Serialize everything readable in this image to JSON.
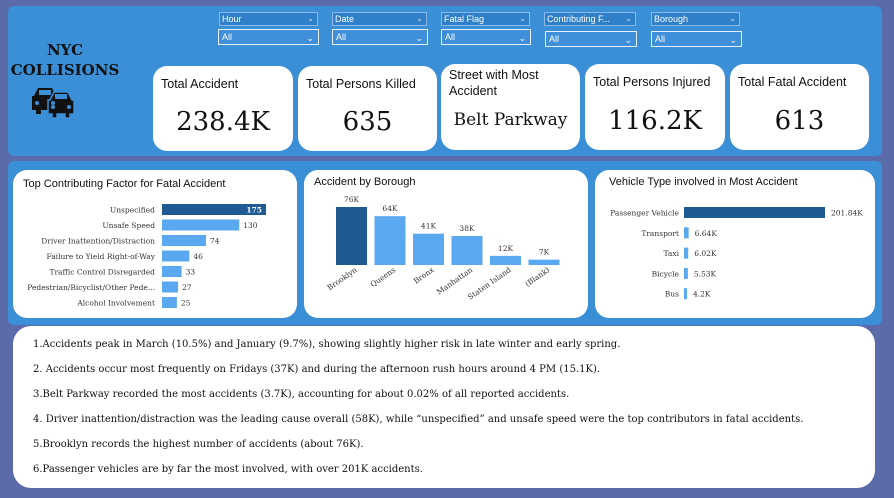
{
  "brand": {
    "line1": "NYC",
    "line2": "COLLISIONS"
  },
  "filters": [
    {
      "label": "Hour",
      "value": "All"
    },
    {
      "label": "Date",
      "value": "All"
    },
    {
      "label": "Fatal Flag",
      "value": "All"
    },
    {
      "label": "Contributing F...",
      "value": "All"
    },
    {
      "label": "Borough",
      "value": "All"
    }
  ],
  "kpis": [
    {
      "title": "Total Accident",
      "value": "238.4K"
    },
    {
      "title": "Total Persons Killed",
      "value": "635"
    },
    {
      "title": "Street with Most Accident",
      "value": "Belt Parkway"
    },
    {
      "title": "Total Persons Injured",
      "value": "116.2K"
    },
    {
      "title": "Total Fatal Accident",
      "value": "613"
    }
  ],
  "colors": {
    "primary_bar": "#1f5a92",
    "secondary_bar": "#5aa8f0",
    "band": "#3a8fd6",
    "background": "#5b6aa8"
  },
  "icons": {
    "brand": "car-icon"
  },
  "chart_data": [
    {
      "type": "bar",
      "orientation": "horizontal",
      "title": "Top Contributing Factor for Fatal Accident",
      "categories": [
        "Unspecified",
        "Unsafe Speed",
        "Driver Inattention/Distraction",
        "Failure to Yield Right-of-Way",
        "Traffic Control Disregarded",
        "Pedestrian/Bicyclist/Other Pede...",
        "Alcohol Involvement"
      ],
      "values": [
        175,
        130,
        74,
        46,
        33,
        27,
        25
      ],
      "data_labels": [
        "175",
        "130",
        "74",
        "46",
        "33",
        "27",
        "25"
      ],
      "highlight_index": 0
    },
    {
      "type": "bar",
      "orientation": "vertical",
      "title": "Accident by Borough",
      "categories": [
        "Brooklyn",
        "Queens",
        "Bronx",
        "Manhattan",
        "Staten Island",
        "(Blank)"
      ],
      "values": [
        76,
        64,
        41,
        38,
        12,
        7
      ],
      "data_labels": [
        "76K",
        "64K",
        "41K",
        "38K",
        "12K",
        "7K"
      ],
      "highlight_index": 0
    },
    {
      "type": "bar",
      "orientation": "horizontal",
      "title": "Vehicle Type involved in Most Accident",
      "categories": [
        "Passenger Vehicle",
        "Transport",
        "Taxi",
        "Bicycle",
        "Bus"
      ],
      "values": [
        201.84,
        6.64,
        6.02,
        5.53,
        4.2
      ],
      "data_labels": [
        "201.84K",
        "6.64K",
        "6.02K",
        "5.53K",
        "4.2K"
      ],
      "highlight_index": 0
    }
  ],
  "insights": [
    "1.Accidents peak in March (10.5%) and January (9.7%), showing slightly higher risk in late winter and early spring.",
    "2. Accidents occur most frequently on Fridays (37K) and during the afternoon rush hours around 4 PM (15.1K).",
    "3.Belt Parkway recorded the most accidents (3.7K), accounting for about 0.02% of all reported accidents.",
    "4. Driver inattention/distraction was the leading cause overall (58K), while “unspecified” and unsafe speed were the top contributors in fatal accidents.",
    " 5.Brooklyn records the highest number of accidents (about 76K).",
    "6.Passenger vehicles are by far the most involved, with over 201K accidents."
  ]
}
